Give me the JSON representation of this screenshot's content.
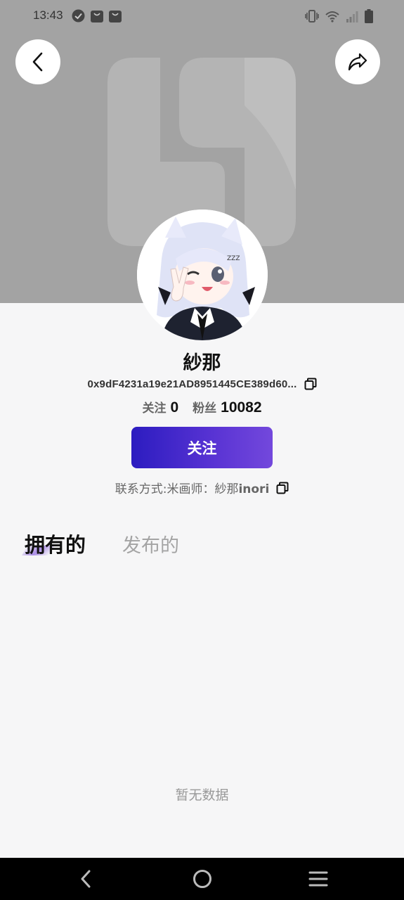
{
  "status_bar": {
    "time": "13:43",
    "left_icons": [
      "check-circle-icon",
      "bag-icon",
      "bag-icon"
    ],
    "right_icons": [
      "vibrate-icon",
      "wifi-icon",
      "signal-icon",
      "battery-icon"
    ]
  },
  "colors": {
    "banner": "#a3a3a3",
    "accent_start": "#2c1cc0",
    "accent_end": "#7348dc",
    "background": "#f6f6f7"
  },
  "profile": {
    "name": "紗那",
    "address": "0x9dF4231a19e21AD8951445CE389d60...",
    "following_label": "关注",
    "following_count": "0",
    "followers_label": "粉丝",
    "followers_count": "10082",
    "follow_button_label": "关注",
    "contact_prefix": "联系方式:米画师：紗那",
    "contact_handle": "inori"
  },
  "tabs": [
    {
      "label": "拥有的",
      "active": true
    },
    {
      "label": "发布的",
      "active": false
    }
  ],
  "empty_state": "暂无数据",
  "nav": [
    "back-icon",
    "home-icon",
    "menu-icon"
  ]
}
